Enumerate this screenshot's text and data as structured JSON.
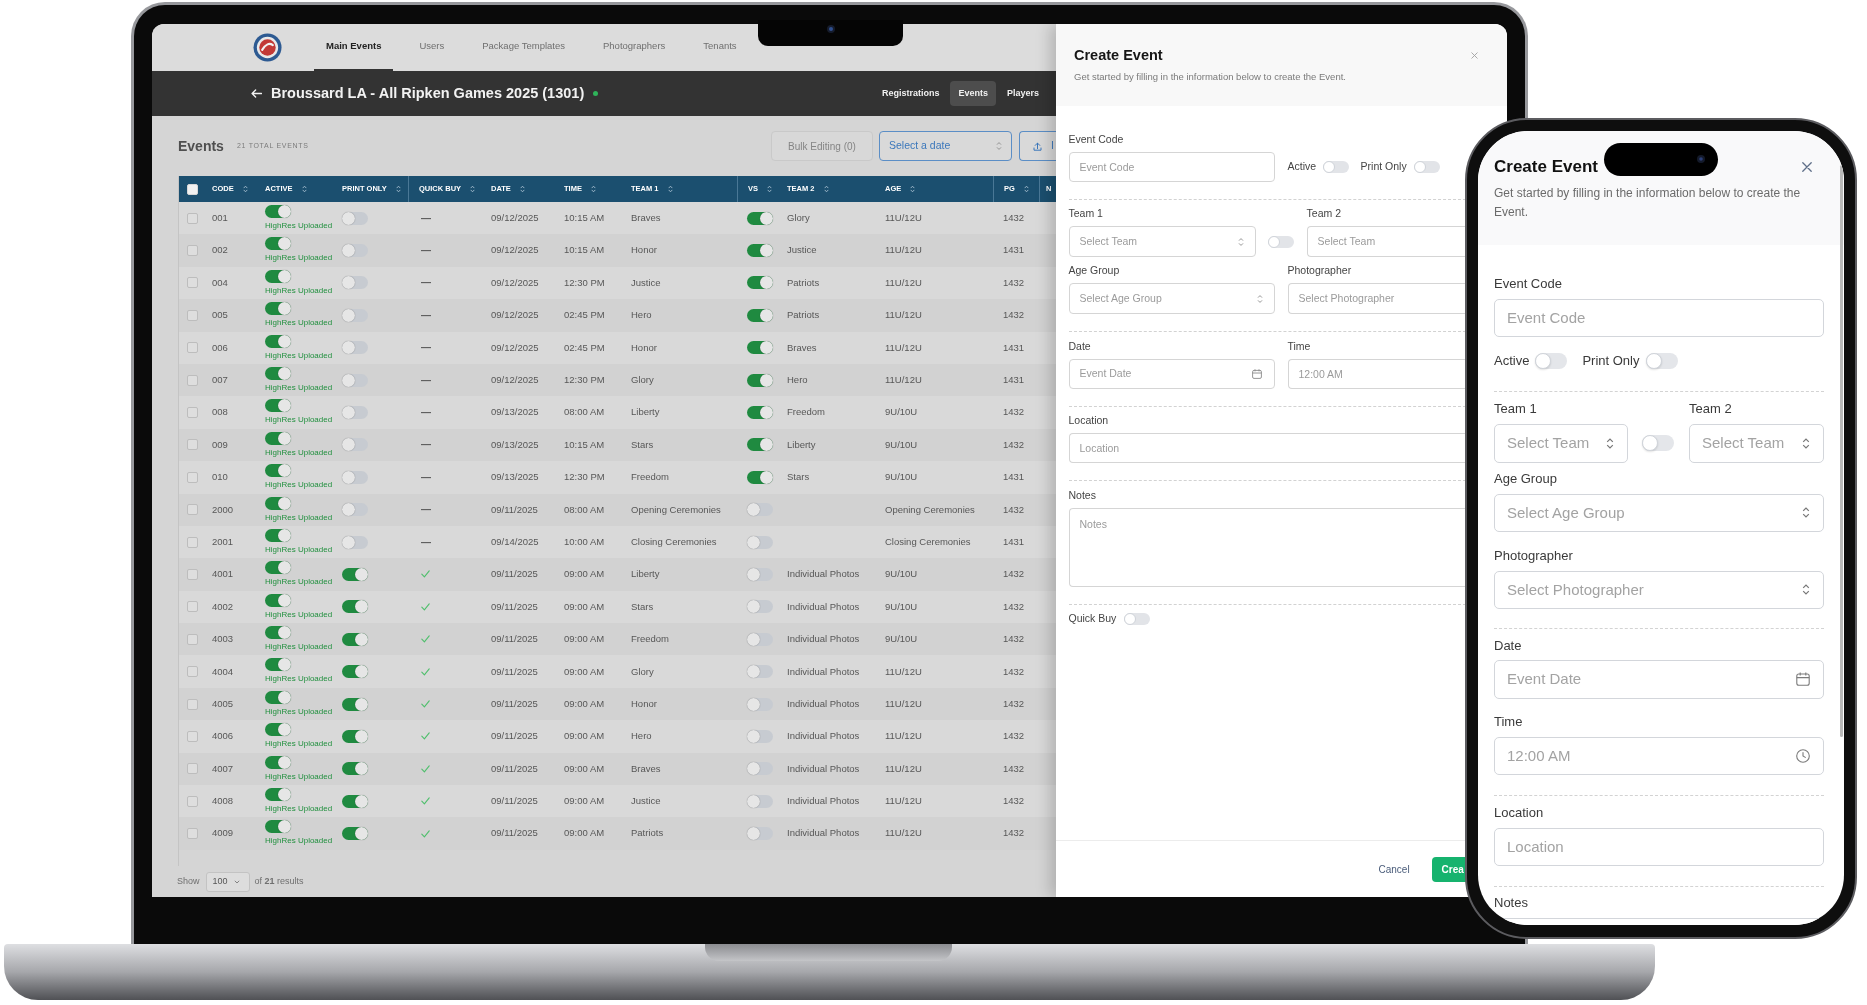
{
  "laptop_screen": {
    "nav": {
      "tabs": [
        {
          "label": "Main Events",
          "selected": true
        },
        {
          "label": "Users",
          "selected": false
        },
        {
          "label": "Package Templates",
          "selected": false
        },
        {
          "label": "Photographers",
          "selected": false
        },
        {
          "label": "Tenants",
          "selected": false
        }
      ]
    },
    "event_header": {
      "title": "Broussard LA - All Ripken Games 2025 (1301)",
      "online": true,
      "tabs": [
        {
          "label": "Registrations",
          "selected": false
        },
        {
          "label": "Events",
          "selected": true
        },
        {
          "label": "Players",
          "selected": false
        }
      ]
    },
    "events_toolbar": {
      "title": "Events",
      "count": "21 TOTAL EVENTS",
      "bulk_editing_button": "Bulk Editing (0)",
      "date_select": {
        "placeholder": "Select a date"
      },
      "upload_button": "I"
    },
    "table": {
      "select_all_checked": false,
      "columns": [
        "CODE",
        "ACTIVE",
        "PRINT ONLY",
        "QUICK BUY",
        "DATE",
        "TIME",
        "TEAM 1",
        "VS",
        "TEAM 2",
        "AGE",
        "PG",
        "N"
      ],
      "rows": [
        {
          "selected": false,
          "code": "001",
          "active": true,
          "active_note": "HighRes Uploaded",
          "print_only": false,
          "quick_buy": false,
          "quick_buy_text": "—",
          "date": "09/12/2025",
          "time": "10:15 AM",
          "team_1": "Braves",
          "vs": true,
          "team_2": "Glory",
          "age": "11U/12U",
          "pg": "1432"
        },
        {
          "selected": false,
          "code": "002",
          "active": true,
          "active_note": "HighRes Uploaded",
          "print_only": false,
          "quick_buy": false,
          "quick_buy_text": "—",
          "date": "09/12/2025",
          "time": "10:15 AM",
          "team_1": "Honor",
          "vs": true,
          "team_2": "Justice",
          "age": "11U/12U",
          "pg": "1431"
        },
        {
          "selected": false,
          "code": "004",
          "active": true,
          "active_note": "HighRes Uploaded",
          "print_only": false,
          "quick_buy": false,
          "quick_buy_text": "—",
          "date": "09/12/2025",
          "time": "12:30 PM",
          "team_1": "Justice",
          "vs": true,
          "team_2": "Patriots",
          "age": "11U/12U",
          "pg": "1432"
        },
        {
          "selected": false,
          "code": "005",
          "active": true,
          "active_note": "HighRes Uploaded",
          "print_only": false,
          "quick_buy": false,
          "quick_buy_text": "—",
          "date": "09/12/2025",
          "time": "02:45 PM",
          "team_1": "Hero",
          "vs": true,
          "team_2": "Patriots",
          "age": "11U/12U",
          "pg": "1432"
        },
        {
          "selected": false,
          "code": "006",
          "active": true,
          "active_note": "HighRes Uploaded",
          "print_only": false,
          "quick_buy": false,
          "quick_buy_text": "—",
          "date": "09/12/2025",
          "time": "02:45 PM",
          "team_1": "Honor",
          "vs": true,
          "team_2": "Braves",
          "age": "11U/12U",
          "pg": "1431"
        },
        {
          "selected": false,
          "code": "007",
          "active": true,
          "active_note": "HighRes Uploaded",
          "print_only": false,
          "quick_buy": false,
          "quick_buy_text": "—",
          "date": "09/12/2025",
          "time": "12:30 PM",
          "team_1": "Glory",
          "vs": true,
          "team_2": "Hero",
          "age": "11U/12U",
          "pg": "1431"
        },
        {
          "selected": false,
          "code": "008",
          "active": true,
          "active_note": "HighRes Uploaded",
          "print_only": false,
          "quick_buy": false,
          "quick_buy_text": "—",
          "date": "09/13/2025",
          "time": "08:00 AM",
          "team_1": "Liberty",
          "vs": true,
          "team_2": "Freedom",
          "age": "9U/10U",
          "pg": "1432"
        },
        {
          "selected": false,
          "code": "009",
          "active": true,
          "active_note": "HighRes Uploaded",
          "print_only": false,
          "quick_buy": false,
          "quick_buy_text": "—",
          "date": "09/13/2025",
          "time": "10:15 AM",
          "team_1": "Stars",
          "vs": true,
          "team_2": "Liberty",
          "age": "9U/10U",
          "pg": "1432"
        },
        {
          "selected": false,
          "code": "010",
          "active": true,
          "active_note": "HighRes Uploaded",
          "print_only": false,
          "quick_buy": false,
          "quick_buy_text": "—",
          "date": "09/13/2025",
          "time": "12:30 PM",
          "team_1": "Freedom",
          "vs": true,
          "team_2": "Stars",
          "age": "9U/10U",
          "pg": "1431"
        },
        {
          "selected": false,
          "code": "2000",
          "active": true,
          "active_note": "HighRes Uploaded",
          "print_only": false,
          "quick_buy": false,
          "quick_buy_text": "—",
          "date": "09/11/2025",
          "time": "08:00 AM",
          "team_1": "Opening Ceremonies",
          "vs": false,
          "age": "Opening Ceremonies",
          "pg": "1432"
        },
        {
          "selected": false,
          "code": "2001",
          "active": true,
          "active_note": "HighRes Uploaded",
          "print_only": false,
          "quick_buy": false,
          "quick_buy_text": "—",
          "date": "09/14/2025",
          "time": "10:00 AM",
          "team_1": "Closing Ceremonies",
          "vs": false,
          "age": "Closing Ceremonies",
          "pg": "1431"
        },
        {
          "selected": false,
          "code": "4001",
          "active": true,
          "active_note": "HighRes Uploaded",
          "print_only": true,
          "quick_buy": true,
          "date": "09/11/2025",
          "time": "09:00 AM",
          "team_1": "Liberty",
          "vs": false,
          "team_2": "Individual Photos",
          "age": "9U/10U",
          "pg": "1432"
        },
        {
          "selected": false,
          "code": "4002",
          "active": true,
          "active_note": "HighRes Uploaded",
          "print_only": true,
          "quick_buy": true,
          "date": "09/11/2025",
          "time": "09:00 AM",
          "team_1": "Stars",
          "vs": false,
          "team_2": "Individual Photos",
          "age": "9U/10U",
          "pg": "1432"
        },
        {
          "selected": false,
          "code": "4003",
          "active": true,
          "active_note": "HighRes Uploaded",
          "print_only": true,
          "quick_buy": true,
          "date": "09/11/2025",
          "time": "09:00 AM",
          "team_1": "Freedom",
          "vs": false,
          "team_2": "Individual Photos",
          "age": "9U/10U",
          "pg": "1432"
        },
        {
          "selected": false,
          "code": "4004",
          "active": true,
          "active_note": "HighRes Uploaded",
          "print_only": true,
          "quick_buy": true,
          "date": "09/11/2025",
          "time": "09:00 AM",
          "team_1": "Glory",
          "vs": false,
          "team_2": "Individual Photos",
          "age": "11U/12U",
          "pg": "1432"
        },
        {
          "selected": false,
          "code": "4005",
          "active": true,
          "active_note": "HighRes Uploaded",
          "print_only": true,
          "quick_buy": true,
          "date": "09/11/2025",
          "time": "09:00 AM",
          "team_1": "Honor",
          "vs": false,
          "team_2": "Individual Photos",
          "age": "11U/12U",
          "pg": "1432"
        },
        {
          "selected": false,
          "code": "4006",
          "active": true,
          "active_note": "HighRes Uploaded",
          "print_only": true,
          "quick_buy": true,
          "date": "09/11/2025",
          "time": "09:00 AM",
          "team_1": "Hero",
          "vs": false,
          "team_2": "Individual Photos",
          "age": "11U/12U",
          "pg": "1432"
        },
        {
          "selected": false,
          "code": "4007",
          "active": true,
          "active_note": "HighRes Uploaded",
          "print_only": true,
          "quick_buy": true,
          "date": "09/11/2025",
          "time": "09:00 AM",
          "team_1": "Braves",
          "vs": false,
          "team_2": "Individual Photos",
          "age": "11U/12U",
          "pg": "1432"
        },
        {
          "selected": false,
          "code": "4008",
          "active": true,
          "active_note": "HighRes Uploaded",
          "print_only": true,
          "quick_buy": true,
          "date": "09/11/2025",
          "time": "09:00 AM",
          "team_1": "Justice",
          "vs": false,
          "team_2": "Individual Photos",
          "age": "11U/12U",
          "pg": "1432"
        },
        {
          "selected": false,
          "code": "4009",
          "active": true,
          "active_note": "HighRes Uploaded",
          "print_only": true,
          "quick_buy": true,
          "date": "09/11/2025",
          "time": "09:00 AM",
          "team_1": "Patriots",
          "vs": false,
          "team_2": "Individual Photos",
          "age": "11U/12U",
          "pg": "1432"
        }
      ]
    },
    "pagination": {
      "show_label": "Show",
      "page_size": "100",
      "summary": "of **21** results"
    },
    "create_event_modal": {
      "title": "Create Event",
      "description": "Get started by filling in the information below to create the Event.",
      "event_code": {
        "label": "Event Code",
        "placeholder": "Event Code"
      },
      "active": {
        "label": "Active",
        "on": false
      },
      "print_only": {
        "label": "Print Only",
        "on": false
      },
      "team_1": {
        "label": "Team 1",
        "placeholder": "Select Team"
      },
      "vs_toggle": {
        "on": false
      },
      "team_2": {
        "label": "Team 2",
        "placeholder": "Select Team"
      },
      "age_group": {
        "label": "Age Group",
        "placeholder": "Select Age Group"
      },
      "photographer": {
        "label": "Photographer",
        "placeholder": "Select Photographer"
      },
      "date": {
        "label": "Date",
        "placeholder": "Event Date"
      },
      "time": {
        "label": "Time",
        "placeholder": "12:00 AM"
      },
      "location": {
        "label": "Location",
        "placeholder": "Location"
      },
      "notes": {
        "label": "Notes",
        "placeholder": "Notes"
      },
      "quick_buy": {
        "label": "Quick Buy",
        "on": false
      },
      "cancel_button": "Cancel",
      "create_button": "Crea"
    }
  },
  "phone_screen": {
    "create_event_form": {
      "title": "Create Event",
      "description": "Get started by filling in the information below to create the Event.",
      "event_code": {
        "label": "Event Code",
        "placeholder": "Event Code"
      },
      "active": {
        "label": "Active",
        "on": false
      },
      "print_only": {
        "label": "Print Only",
        "on": false
      },
      "team_1": {
        "label": "Team 1",
        "placeholder": "Select Team"
      },
      "vs_toggle": {
        "on": false
      },
      "team_2": {
        "label": "Team 2",
        "placeholder": "Select Team"
      },
      "age_group": {
        "label": "Age Group",
        "placeholder": "Select Age Group"
      },
      "photographer": {
        "label": "Photographer",
        "placeholder": "Select Photographer"
      },
      "date": {
        "label": "Date",
        "placeholder": "Event Date"
      },
      "time": {
        "label": "Time",
        "placeholder": "12:00 AM"
      },
      "location": {
        "label": "Location",
        "placeholder": "Location"
      },
      "notes": {
        "label": "Notes"
      }
    }
  }
}
